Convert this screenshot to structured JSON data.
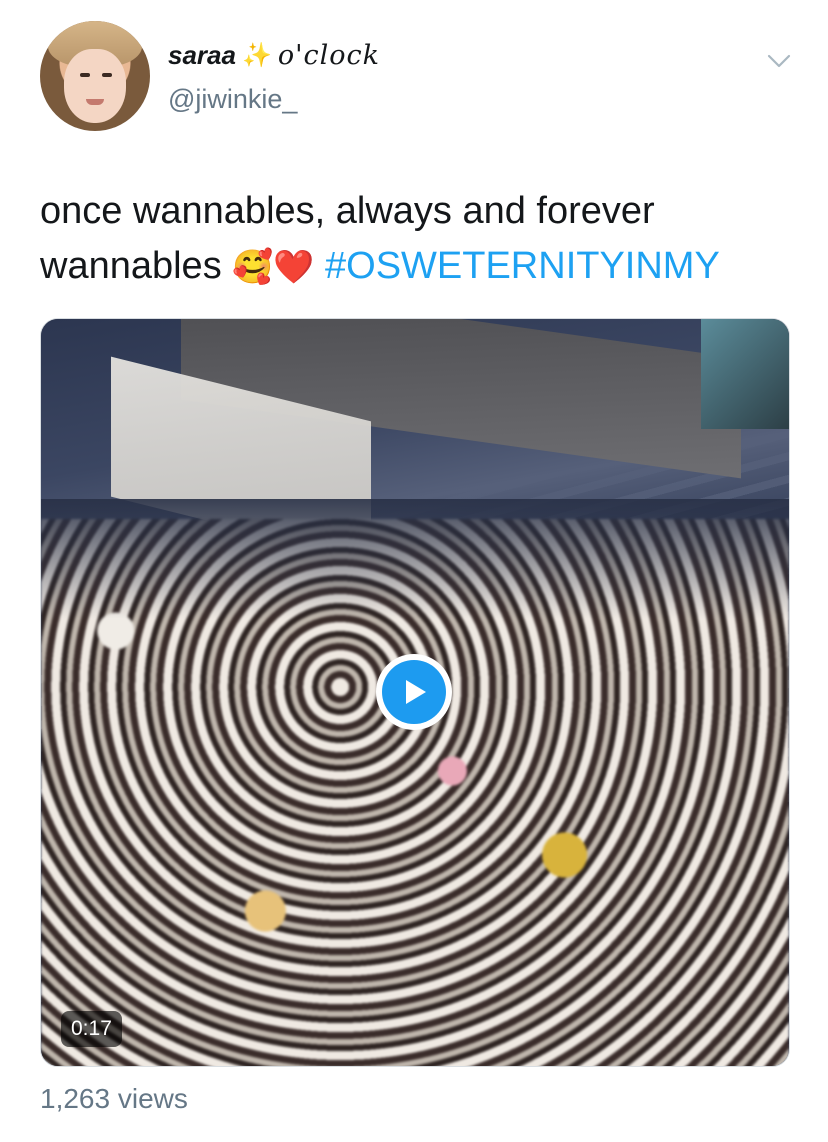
{
  "author": {
    "display_name": "saraa",
    "sparkle_icon": "sparkles-icon",
    "name_suffix": "o'clock",
    "handle": "@jiwinkie_",
    "avatar_icon": "user-avatar"
  },
  "menu": {
    "icon": "chevron-down-icon"
  },
  "tweet": {
    "text_line1": "once wannables, always and forever",
    "text_line2": "wannables",
    "emojis": "🥰❤️",
    "hashtag": "#OSWETERNITYINMY"
  },
  "media": {
    "type": "video",
    "duration": "0:17",
    "play_icon": "play-icon"
  },
  "stats": {
    "views": "1,263 views"
  },
  "colors": {
    "link": "#1da1f2",
    "secondary_text": "#657786",
    "primary_text": "#14171a"
  }
}
